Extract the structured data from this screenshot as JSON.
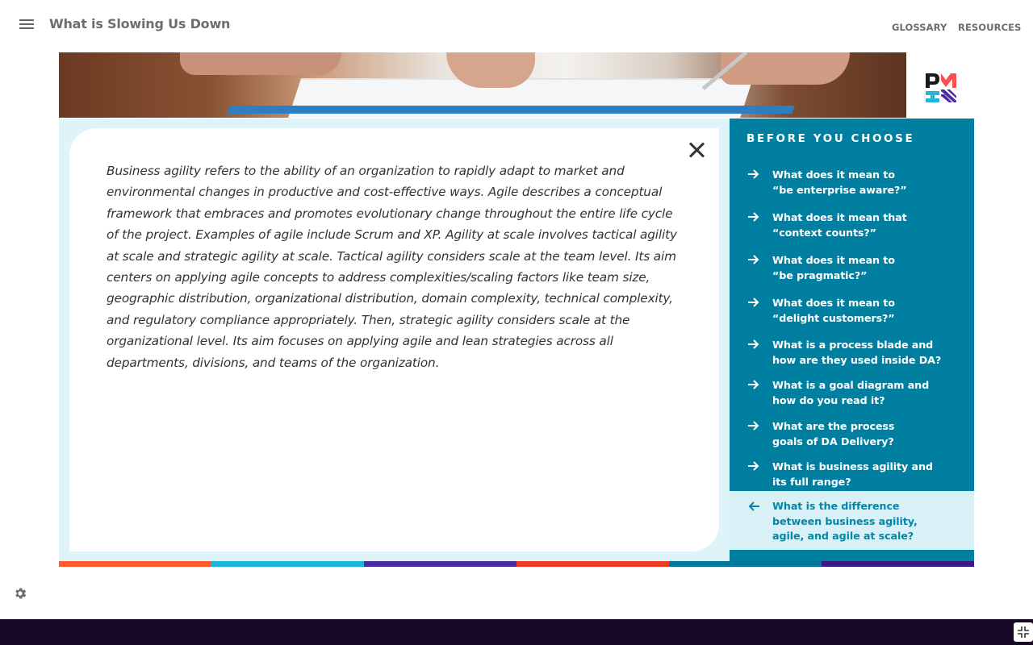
{
  "header": {
    "title": "What is Slowing Us Down",
    "nav": {
      "glossary": "GLOSSARY",
      "resources": "RESOURCES"
    }
  },
  "logo": {
    "icon": "pmi-logo",
    "text": "PMI"
  },
  "content": {
    "paragraph": "Business agility refers to the ability of an organization to rapidly adapt to market and environmental changes in productive and cost-effective ways. Agile describes a conceptual framework that embraces and promotes evolutionary change throughout the entire life cycle of the project. Examples of agile include Scrum and XP. Agility at scale involves tactical agility at scale and strategic agility at scale. Tactical agility considers scale at the team level. Its aim centers on applying agile concepts to address complexities/scaling factors like team size, geographic distribution, organizational distribution, domain complexity, technical complexity, and regulatory compliance appropriately. Then, strategic agility considers scale at the organizational level. Its aim focuses on applying agile and lean strategies across all departments, divisions, and teams of the organization."
  },
  "sidebar": {
    "title": "BEFORE YOU CHOOSE",
    "items": [
      {
        "line1": "What does it mean to",
        "line2": "“be enterprise aware?”",
        "icon": "arrow-right-icon"
      },
      {
        "line1": "What does it mean that",
        "line2": "“context counts?”",
        "icon": "arrow-right-icon"
      },
      {
        "line1": "What does it mean to",
        "line2": "“be pragmatic?”",
        "icon": "arrow-right-icon"
      },
      {
        "line1": "What does it mean to",
        "line2": "“delight customers?”",
        "icon": "arrow-right-icon"
      },
      {
        "line1": "What is a process blade and",
        "line2": "how are they used inside DA?",
        "icon": "arrow-right-icon"
      },
      {
        "line1": "What is a goal diagram and",
        "line2": "how do you read it?",
        "icon": "arrow-right-icon"
      },
      {
        "line1": "What are the process",
        "line2": "goals of DA Delivery?",
        "icon": "arrow-right-icon"
      },
      {
        "line1": "What is business agility and",
        "line2": "its full range?",
        "icon": "arrow-right-icon"
      },
      {
        "line1": "What is the difference",
        "line2": "between business agility,",
        "line3": "agile, and agile  at scale?",
        "icon": "arrow-left-icon",
        "active": true
      }
    ]
  },
  "colors": {
    "sidebar_bg": "#007fa0",
    "panel_bg": "#dff4f8",
    "active_text": "#0287a8",
    "bottom_bar": "#180a26",
    "color_bar": [
      "#ff5b2e",
      "#1bb8d7",
      "#4b2aa2",
      "#ef3b24",
      "#00789a",
      "#3c1a85"
    ]
  }
}
